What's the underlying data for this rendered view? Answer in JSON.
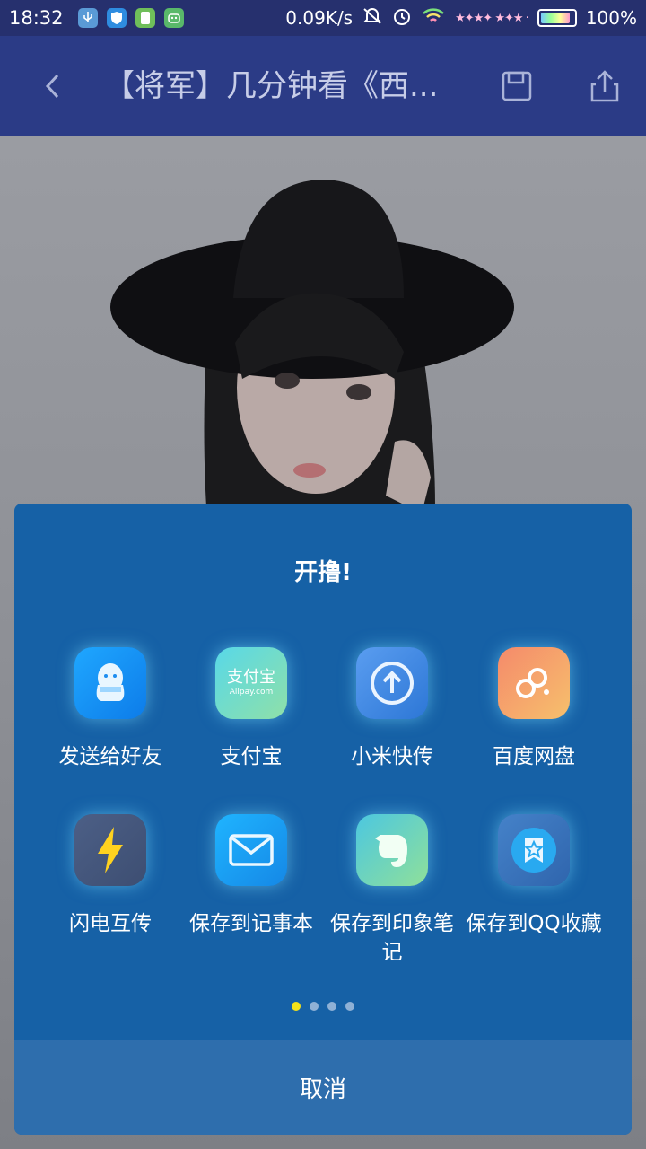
{
  "status_bar": {
    "time": "18:32",
    "network_speed": "0.09K/s",
    "battery_percent": "100%",
    "icons": [
      "usb-icon",
      "shield-icon",
      "app-icon",
      "robot-icon",
      "mute-icon",
      "alarm-icon",
      "wifi-icon",
      "battery-icon"
    ]
  },
  "header": {
    "title": "【将军】几分钟看《西...",
    "back_icon": "chevron-left-icon",
    "save_icon": "save-icon",
    "share_icon": "share-icon"
  },
  "share_sheet": {
    "title": "开撸!",
    "items": [
      {
        "label": "发送给好友",
        "icon": "qq-icon"
      },
      {
        "label": "支付宝",
        "icon": "alipay-icon"
      },
      {
        "label": "小米快传",
        "icon": "mi-drop-icon"
      },
      {
        "label": "百度网盘",
        "icon": "baidu-netdisk-icon"
      },
      {
        "label": "闪电互传",
        "icon": "lightning-icon"
      },
      {
        "label": "保存到记事本",
        "icon": "mail-icon"
      },
      {
        "label": "保存到印象笔记",
        "icon": "evernote-icon"
      },
      {
        "label": "保存到QQ收藏",
        "icon": "qq-favorite-icon"
      }
    ],
    "alipay_text": "支付宝",
    "alipay_sub": "Alipay.com",
    "pages": 4,
    "active_page": 1,
    "cancel_label": "取消"
  },
  "colors": {
    "header_bg": "#2b3b86",
    "sheet_bg": "#1661a6",
    "cancel_bg": "#2e6ead",
    "active_dot": "#f4e21a"
  }
}
